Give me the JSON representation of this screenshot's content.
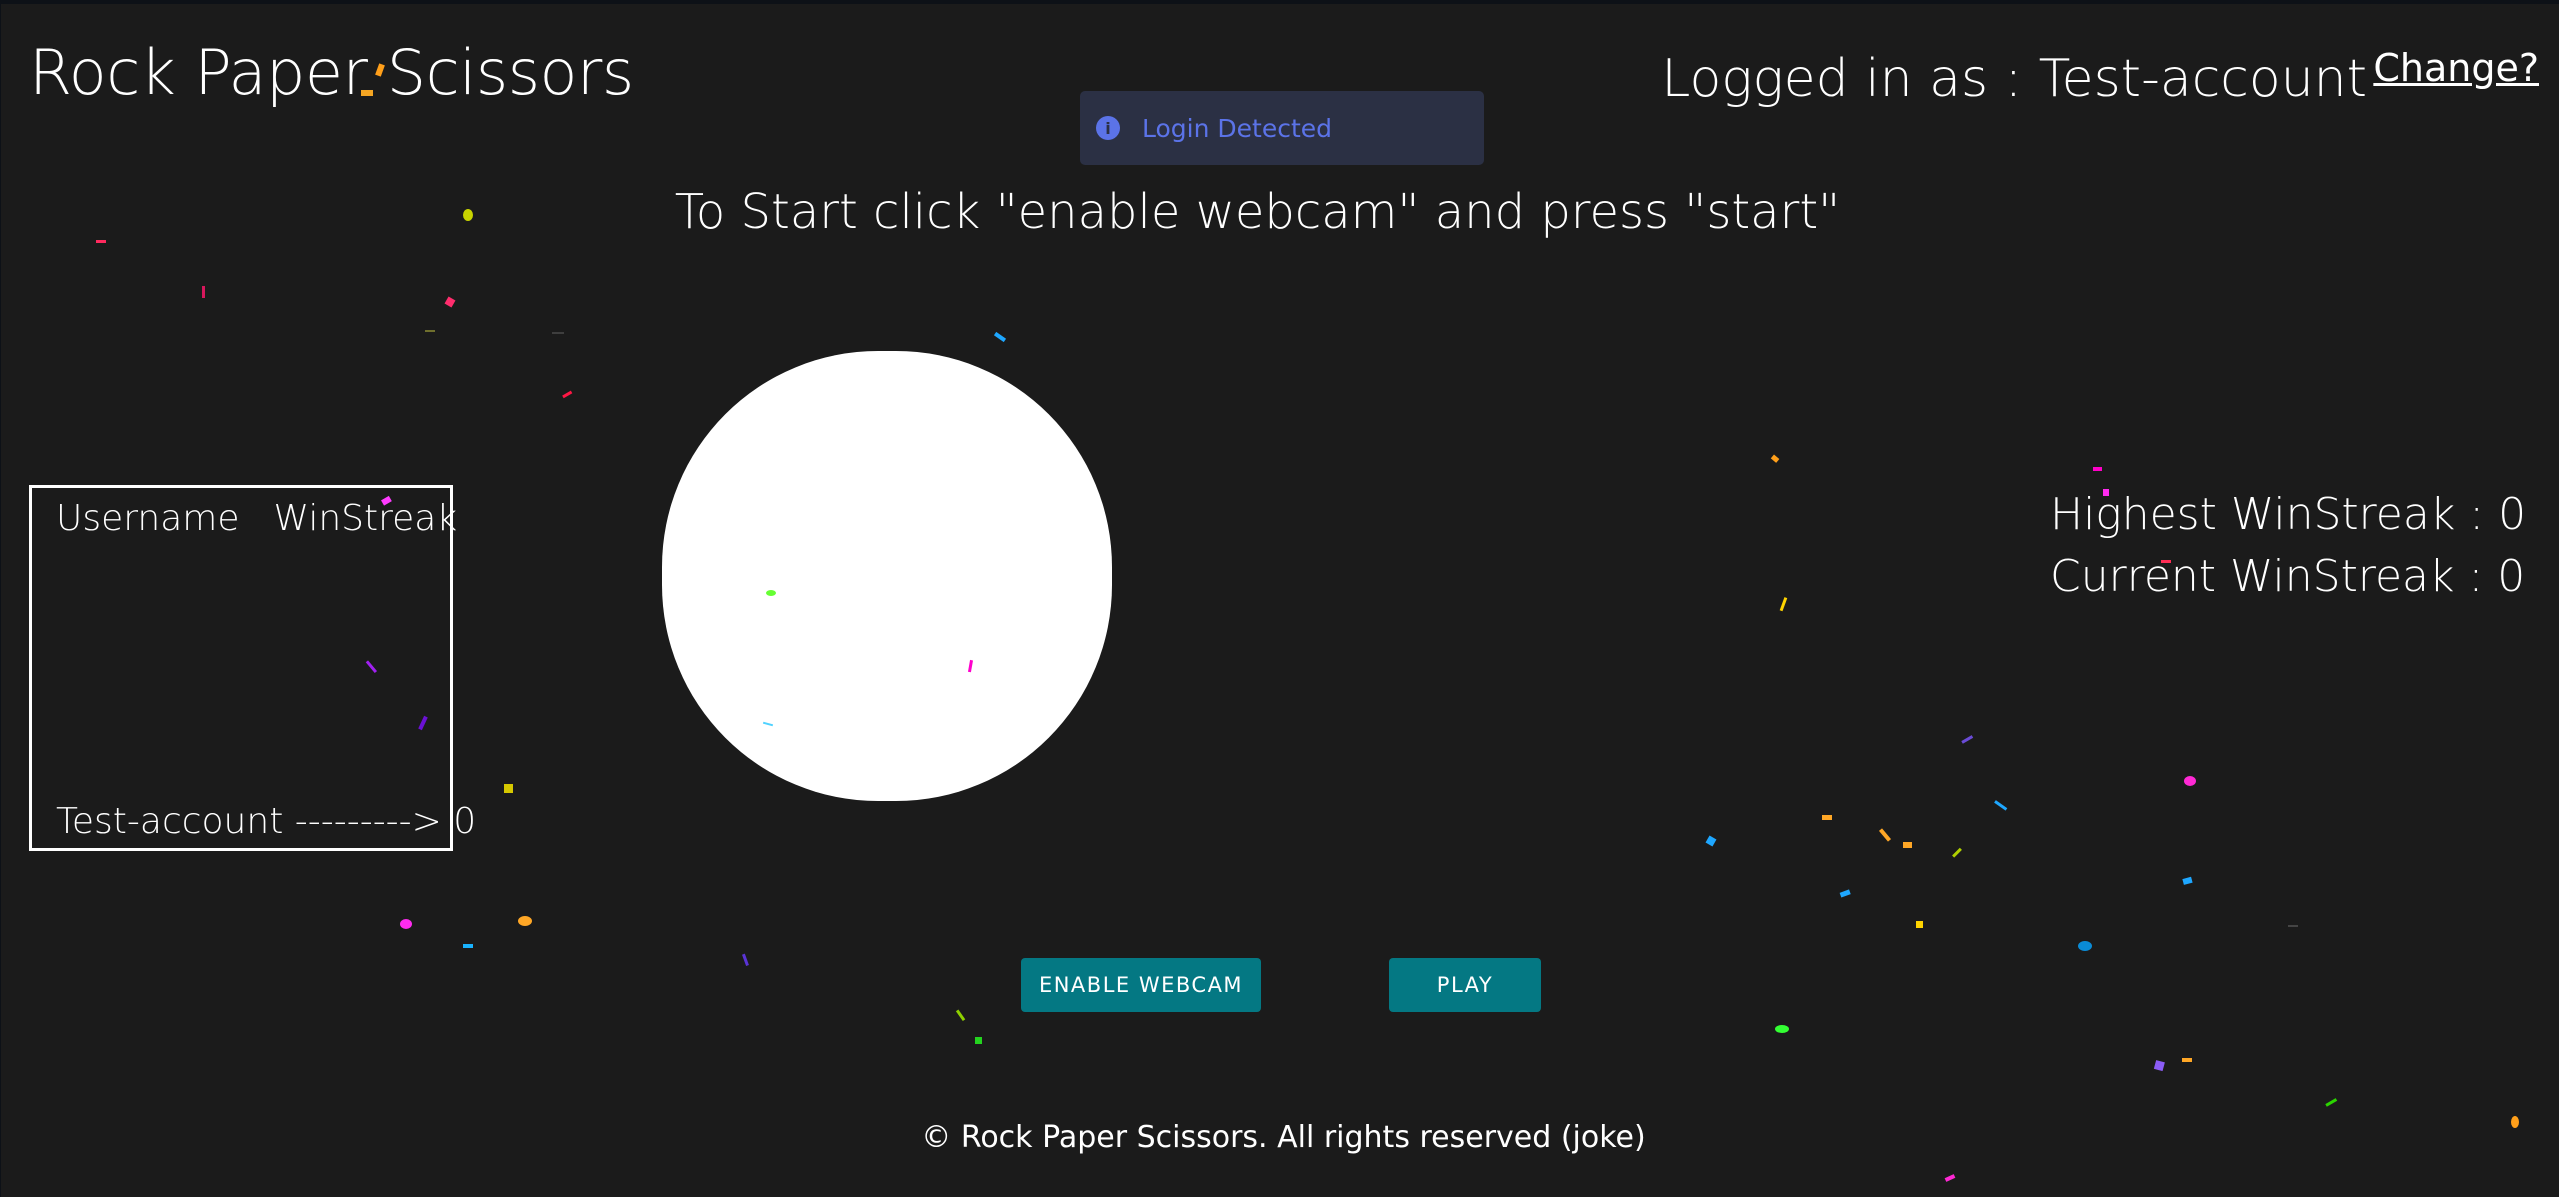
{
  "header": {
    "title": "Rock Paper Scissors",
    "login_status": "Logged in as : Test-account",
    "change_link": "Change?"
  },
  "toast": {
    "icon": "info-icon",
    "message": "Login Detected",
    "color": "#5b73e8"
  },
  "instructions": "To Start click \"enable webcam\" and press \"start\"",
  "leaderboard": {
    "columns": [
      "Username",
      "WinStreak"
    ],
    "rows": [
      {
        "text": "Test-account ---------> 0"
      }
    ]
  },
  "stats": {
    "highest": "Highest WinStreak : 0",
    "current": "Current WinStreak : 0"
  },
  "buttons": {
    "enable_webcam": "ENABLE WEBCAM",
    "play": "PLAY",
    "color": "#047883"
  },
  "footer": "© Rock Paper Scissors. All rights reserved (joke)"
}
